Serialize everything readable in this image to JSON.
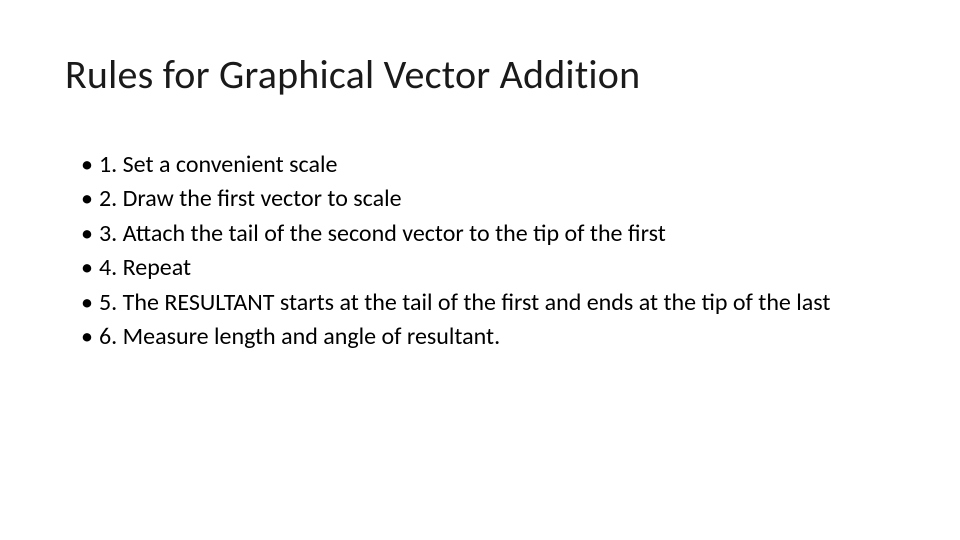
{
  "title": "Rules for Graphical Vector Addition",
  "items": [
    "1.  Set a convenient scale",
    "2.  Draw the first vector to scale",
    "3.  Attach the tail of the second vector to the tip of the first",
    "4.  Repeat",
    "5.  The RESULTANT starts at the tail of the first and ends at the tip of the last",
    "6. Measure length and angle of resultant."
  ]
}
